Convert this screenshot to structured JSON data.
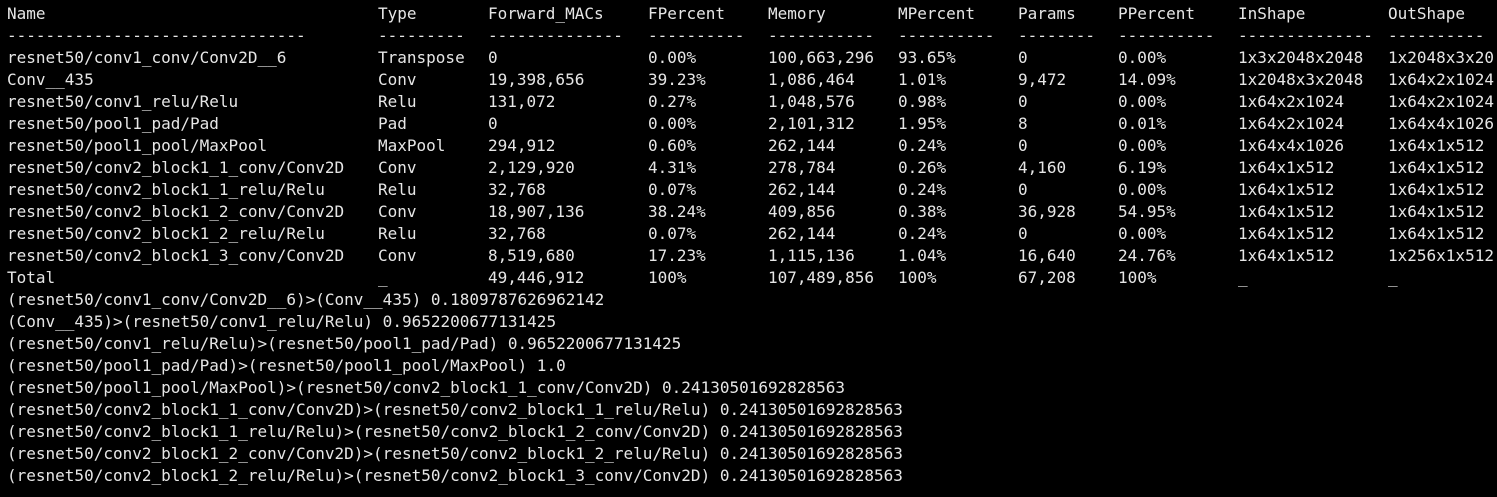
{
  "terminal": {
    "header": [
      "Name",
      "Type",
      "Forward_MACs",
      "FPercent",
      "Memory",
      "MPercent",
      "Params",
      "PPercent",
      "InShape",
      "OutShape"
    ],
    "separator": [
      "-------------------------------",
      "---------",
      "--------------",
      "----------",
      "-----------",
      "----------",
      "--------",
      "----------",
      "--------------",
      "----------"
    ],
    "rows": [
      [
        "resnet50/conv1_conv/Conv2D__6",
        "Transpose",
        "0",
        "0.00%",
        "100,663,296",
        "93.65%",
        "0",
        "0.00%",
        "1x3x2048x2048",
        "1x2048x3x20"
      ],
      [
        "Conv__435",
        "Conv",
        "19,398,656",
        "39.23%",
        "1,086,464",
        "1.01%",
        "9,472",
        "14.09%",
        "1x2048x3x2048",
        "1x64x2x1024"
      ],
      [
        "resnet50/conv1_relu/Relu",
        "Relu",
        "131,072",
        "0.27%",
        "1,048,576",
        "0.98%",
        "0",
        "0.00%",
        "1x64x2x1024",
        "1x64x2x1024"
      ],
      [
        "resnet50/pool1_pad/Pad",
        "Pad",
        "0",
        "0.00%",
        "2,101,312",
        "1.95%",
        "8",
        "0.01%",
        "1x64x2x1024",
        "1x64x4x1026"
      ],
      [
        "resnet50/pool1_pool/MaxPool",
        "MaxPool",
        "294,912",
        "0.60%",
        "262,144",
        "0.24%",
        "0",
        "0.00%",
        "1x64x4x1026",
        "1x64x1x512"
      ],
      [
        "resnet50/conv2_block1_1_conv/Conv2D",
        "Conv",
        "2,129,920",
        "4.31%",
        "278,784",
        "0.26%",
        "4,160",
        "6.19%",
        "1x64x1x512",
        "1x64x1x512"
      ],
      [
        "resnet50/conv2_block1_1_relu/Relu",
        "Relu",
        "32,768",
        "0.07%",
        "262,144",
        "0.24%",
        "0",
        "0.00%",
        "1x64x1x512",
        "1x64x1x512"
      ],
      [
        "resnet50/conv2_block1_2_conv/Conv2D",
        "Conv",
        "18,907,136",
        "38.24%",
        "409,856",
        "0.38%",
        "36,928",
        "54.95%",
        "1x64x1x512",
        "1x64x1x512"
      ],
      [
        "resnet50/conv2_block1_2_relu/Relu",
        "Relu",
        "32,768",
        "0.07%",
        "262,144",
        "0.24%",
        "0",
        "0.00%",
        "1x64x1x512",
        "1x64x1x512"
      ],
      [
        "resnet50/conv2_block1_3_conv/Conv2D",
        "Conv",
        "8,519,680",
        "17.23%",
        "1,115,136",
        "1.04%",
        "16,640",
        "24.76%",
        "1x64x1x512",
        "1x256x1x512"
      ],
      [
        "Total",
        "_",
        "49,446,912",
        "100%",
        "107,489,856",
        "100%",
        "67,208",
        "100%",
        "_",
        "_"
      ]
    ],
    "log_lines": [
      "(resnet50/conv1_conv/Conv2D__6)>(Conv__435) 0.1809787626962142",
      "(Conv__435)>(resnet50/conv1_relu/Relu) 0.9652200677131425",
      "(resnet50/conv1_relu/Relu)>(resnet50/pool1_pad/Pad) 0.9652200677131425",
      "(resnet50/pool1_pad/Pad)>(resnet50/pool1_pool/MaxPool) 1.0",
      "(resnet50/pool1_pool/MaxPool)>(resnet50/conv2_block1_1_conv/Conv2D) 0.24130501692828563",
      "(resnet50/conv2_block1_1_conv/Conv2D)>(resnet50/conv2_block1_1_relu/Relu) 0.24130501692828563",
      "(resnet50/conv2_block1_1_relu/Relu)>(resnet50/conv2_block1_2_conv/Conv2D) 0.24130501692828563",
      "(resnet50/conv2_block1_2_conv/Conv2D)>(resnet50/conv2_block1_2_relu/Relu) 0.24130501692828563",
      "(resnet50/conv2_block1_2_relu/Relu)>(resnet50/conv2_block1_3_conv/Conv2D) 0.24130501692828563"
    ],
    "colors": {
      "background": "#000000",
      "text": "#e6e6e6"
    }
  }
}
